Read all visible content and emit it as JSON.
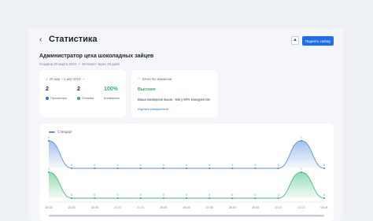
{
  "header": {
    "title": "Статистика",
    "back_icon": "chevron-left-icon",
    "action_icon": "person-icon",
    "primary_button": "Поднять сайзку"
  },
  "job": {
    "title": "Администратор цеха шоколадных зайцев",
    "created": "Создана 20 марта 2024",
    "separator": "•",
    "expires": "Истекает через 19 дней"
  },
  "stats": {
    "date_range": "20 мар – 1 апр 2024",
    "views": {
      "value": "2",
      "label": "Просмотры",
      "color": "#1f6feb"
    },
    "responses": {
      "value": "2",
      "label": "Отклики",
      "color": "#2fb56a"
    },
    "conversion": {
      "value": "100%",
      "label": "Конверсия",
      "color": "#2fb56a"
    }
  },
  "quality": {
    "header": "Качество вакансии",
    "level": "Высокое",
    "description": "Ваша конверсия выше, чем у 90% конкурентов",
    "link": "Изучить конкурентов"
  },
  "chart": {
    "legend": "Стандарт",
    "colors": {
      "views": "#5b8fe0",
      "responses": "#3dbe78",
      "weekend": "#e57373",
      "axis": "#6b7385"
    }
  },
  "chart_data": {
    "type": "area",
    "categories": [
      "20.03",
      "21.03",
      "22.03",
      "23.03",
      "24.03",
      "25.03",
      "26.03",
      "27.03",
      "28.03",
      "29.03",
      "30.03",
      "31.03",
      "01.04"
    ],
    "weekend_categories": [
      "23.03",
      "24.03",
      "30.03",
      "31.03"
    ],
    "series": [
      {
        "name": "Стандарт",
        "values": [
          1,
          0,
          0,
          0,
          0,
          0,
          0,
          0,
          0,
          0,
          0,
          1,
          0
        ]
      },
      {
        "values": [
          1,
          0,
          0,
          0,
          0,
          0,
          0,
          0,
          0,
          0,
          0,
          1,
          0
        ]
      }
    ]
  }
}
